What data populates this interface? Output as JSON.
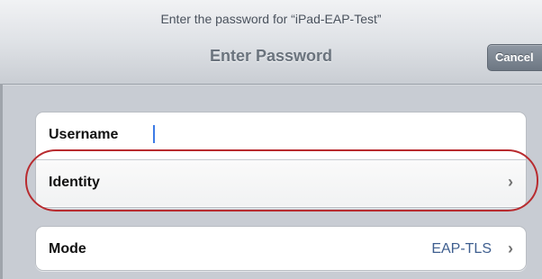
{
  "header": {
    "prompt": "Enter the password for “iPad-EAP-Test”",
    "title": "Enter Password",
    "cancel_label": "Cancel"
  },
  "form": {
    "username_label": "Username",
    "username_value": "",
    "identity_label": "Identity",
    "mode_label": "Mode",
    "mode_value": "EAP-TLS"
  },
  "icons": {
    "disclosure": "chevron-right-icon"
  },
  "colors": {
    "highlight": "#b82b2f",
    "caret": "#3d7be6",
    "value_text": "#3e5e8f"
  }
}
